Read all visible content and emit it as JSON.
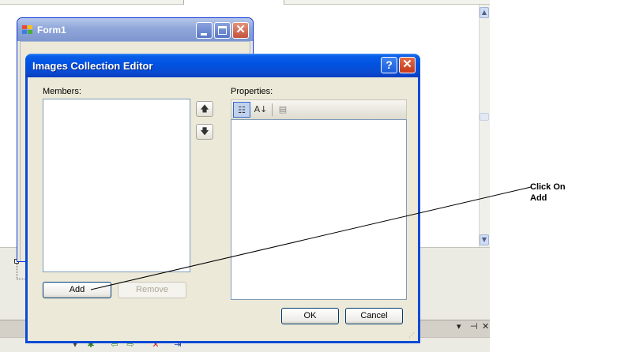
{
  "form1": {
    "title": "Form1"
  },
  "dialog": {
    "title": "Images Collection Editor",
    "members_label": "Members:",
    "properties_label": "Properties:",
    "add_label": "Add",
    "remove_label": "Remove",
    "ok_label": "OK",
    "cancel_label": "Cancel",
    "help_glyph": "?",
    "close_glyph": "✕"
  },
  "annotation": {
    "line1": "Click On",
    "line2": "Add"
  },
  "colors": {
    "dialog_border": "#0a4ad8",
    "form1_title": "#8fa6d9",
    "dialog_face": "#ece9d8"
  },
  "icons": [
    "form-app-icon",
    "minimize-icon",
    "maximize-icon",
    "close-icon",
    "help-icon",
    "move-up-icon",
    "move-down-icon",
    "categorized-icon",
    "alphabetical-icon",
    "property-pages-icon"
  ]
}
